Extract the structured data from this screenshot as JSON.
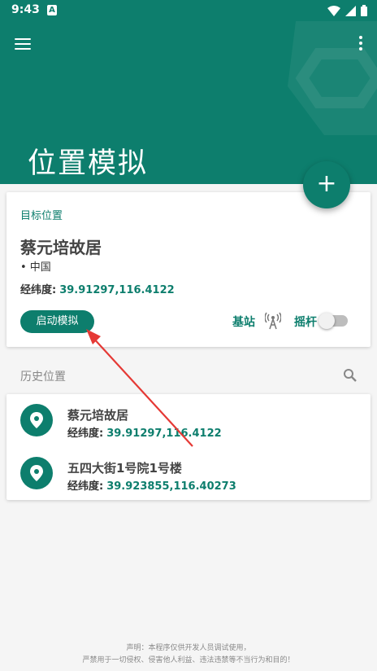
{
  "status_bar": {
    "time": "9:43",
    "notification_icon": "A"
  },
  "header": {
    "title": "位置模拟"
  },
  "fab": {
    "label": "+"
  },
  "target": {
    "section_label": "目标位置",
    "name": "蔡元培故居",
    "country": "• 中国",
    "coord_label": "经纬度:",
    "coord_value": "39.91297,116.4122",
    "start_button": "启动模拟",
    "base_station_label": "基站",
    "joystick_label": "摇杆",
    "joystick_on": false
  },
  "history": {
    "title": "历史位置",
    "items": [
      {
        "name": "蔡元培故居",
        "coord_label": "经纬度:",
        "coord_value": "39.91297,116.4122"
      },
      {
        "name": "五四大街1号院1号楼",
        "coord_label": "经纬度:",
        "coord_value": "39.923855,116.40273"
      }
    ]
  },
  "footer": {
    "line1": "声明：本程序仅供开发人员调试使用，",
    "line2": "严禁用于一切侵权、侵害他人利益、违法违禁等不当行为和目的！"
  },
  "colors": {
    "primary": "#0d7e6d",
    "annotation_arrow": "#e53935"
  }
}
